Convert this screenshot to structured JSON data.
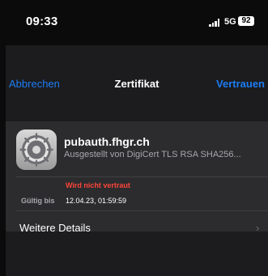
{
  "status_bar": {
    "time": "09:33",
    "network": "5G",
    "battery": "92"
  },
  "nav": {
    "cancel_label": "Abbrechen",
    "title": "Zertifikat",
    "trust_label": "Vertrauen"
  },
  "certificate": {
    "title": "pubauth.fhgr.ch",
    "subtitle": "Ausgestellt von DigiCert TLS RSA SHA256...",
    "status": "Wird nicht vertraut",
    "valid_until_label": "Gültig bis",
    "valid_until_value": "12.04.23, 01:59:59"
  },
  "details": {
    "label": "Weitere Details"
  },
  "colors": {
    "accent": "#1c7cf4",
    "danger": "#ff453a",
    "background": "#0b0b0c",
    "sheet": "#1c1c1e",
    "card": "#2c2c2e"
  }
}
